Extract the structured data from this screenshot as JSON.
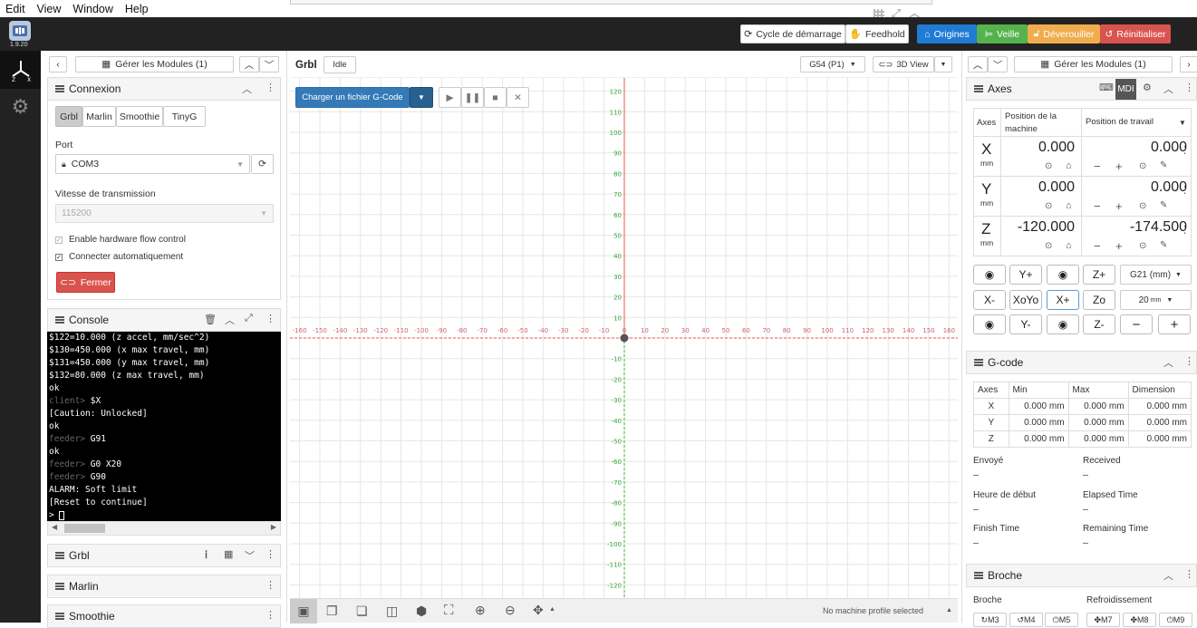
{
  "menu": [
    "Edit",
    "View",
    "Window",
    "Help"
  ],
  "app": {
    "version": "1.9.20"
  },
  "header": {
    "cycle": "Cycle de démarrage",
    "feedhold": "Feedhold",
    "origines": "Origines",
    "veille": "Veille",
    "deverouiller": "Déverouiller",
    "reinitialiser": "Réinitialiser",
    "colors": {
      "blue": "#1f7bd3",
      "green": "#55b24d",
      "orange": "#f0ad4e",
      "red": "#d9534f"
    }
  },
  "left_panel": {
    "modules_label": "Gérer les Modules (1)",
    "connexion": {
      "title": "Connexion",
      "tabs": [
        "Grbl",
        "Marlin",
        "Smoothie",
        "TinyG"
      ],
      "port_label": "Port",
      "port_value": "COM3",
      "baud_label": "Vitesse de transmission",
      "baud_value": "115200",
      "flow_label": "Enable hardware flow control",
      "auto_label": "Connecter automatiquement",
      "close_label": "Fermer"
    },
    "console": {
      "title": "Console",
      "lines": [
        {
          "p": "",
          "t": "$122=10.000 (z accel, mm/sec^2)"
        },
        {
          "p": "",
          "t": "$130=450.000 (x max travel, mm)"
        },
        {
          "p": "",
          "t": "$131=450.000 (y max travel, mm)"
        },
        {
          "p": "",
          "t": "$132=80.000 (z max travel, mm)"
        },
        {
          "p": "",
          "t": "ok"
        },
        {
          "p": "client> ",
          "t": "$X"
        },
        {
          "p": "",
          "t": "[Caution: Unlocked]"
        },
        {
          "p": "",
          "t": "ok"
        },
        {
          "p": "feeder> ",
          "t": "G91"
        },
        {
          "p": "",
          "t": "ok"
        },
        {
          "p": "feeder> ",
          "t": "G0 X20"
        },
        {
          "p": "feeder> ",
          "t": "G90"
        },
        {
          "p": "",
          "t": "ALARM: Soft limit"
        },
        {
          "p": "",
          "t": "[Reset to continue]"
        },
        {
          "p": "",
          "t": "> "
        }
      ]
    },
    "collapsed": [
      "Grbl",
      "Marlin",
      "Smoothie"
    ]
  },
  "center": {
    "title": "Grbl",
    "state": "Idle",
    "wcs": "G54 (P1)",
    "view": "3D View",
    "load_label": "Charger un fichier G-Code",
    "status": "No machine profile selected",
    "x_ticks": [
      "-160",
      "-150",
      "-140",
      "-130",
      "-120",
      "-110",
      "-100",
      "-90",
      "-80",
      "-70",
      "-60",
      "-50",
      "-40",
      "-30",
      "-20",
      "-10",
      "0",
      "10",
      "20",
      "30",
      "40",
      "50",
      "60",
      "70",
      "80",
      "90",
      "100",
      "110",
      "120",
      "130",
      "140",
      "150",
      "160"
    ],
    "y_ticks": [
      "120",
      "110",
      "100",
      "90",
      "80",
      "70",
      "60",
      "50",
      "40",
      "30",
      "20",
      "10",
      "-10",
      "-20",
      "-30",
      "-40",
      "-50",
      "-60",
      "-70",
      "-80",
      "-90",
      "-100",
      "-110",
      "-120"
    ]
  },
  "right_panel": {
    "modules_label": "Gérer les Modules (1)",
    "axes": {
      "title": "Axes",
      "mdi": "MDI",
      "col_axes": "Axes",
      "col_machine": "Position de la machine",
      "col_work": "Position de travail",
      "rows": [
        {
          "axis": "X",
          "unit": "mm",
          "machine": "0.000",
          "work": "0.000"
        },
        {
          "axis": "Y",
          "unit": "mm",
          "machine": "0.000",
          "work": "0.000"
        },
        {
          "axis": "Z",
          "unit": "mm",
          "machine": "-120.000",
          "work": "-174.500"
        }
      ],
      "jog": {
        "yplus": "Y+",
        "zplus": "Z+",
        "xminus": "X-",
        "xoyo": "XoYo",
        "xplus": "X+",
        "zo": "Zo",
        "yminus": "Y-",
        "zminus": "Z-",
        "units": "G21 (mm)",
        "step": "20",
        "step_unit": "mm"
      }
    },
    "gcode": {
      "title": "G-code",
      "headers": [
        "Axes",
        "Min",
        "Max",
        "Dimension"
      ],
      "rows": [
        [
          "X",
          "0.000 mm",
          "0.000 mm",
          "0.000 mm"
        ],
        [
          "Y",
          "0.000 mm",
          "0.000 mm",
          "0.000 mm"
        ],
        [
          "Z",
          "0.000 mm",
          "0.000 mm",
          "0.000 mm"
        ]
      ],
      "envoye": "Envoyé",
      "received": "Received",
      "heure": "Heure de début",
      "elapsed": "Elapsed Time",
      "finish": "Finish Time",
      "remaining": "Remaining Time",
      "dash": "–"
    },
    "broche": {
      "title": "Broche",
      "broche_label": "Broche",
      "refroid_label": "Refroidissement",
      "m3": "M3",
      "m4": "M4",
      "m5": "M5",
      "m7": "M7",
      "m8": "M8",
      "m9": "M9"
    }
  }
}
